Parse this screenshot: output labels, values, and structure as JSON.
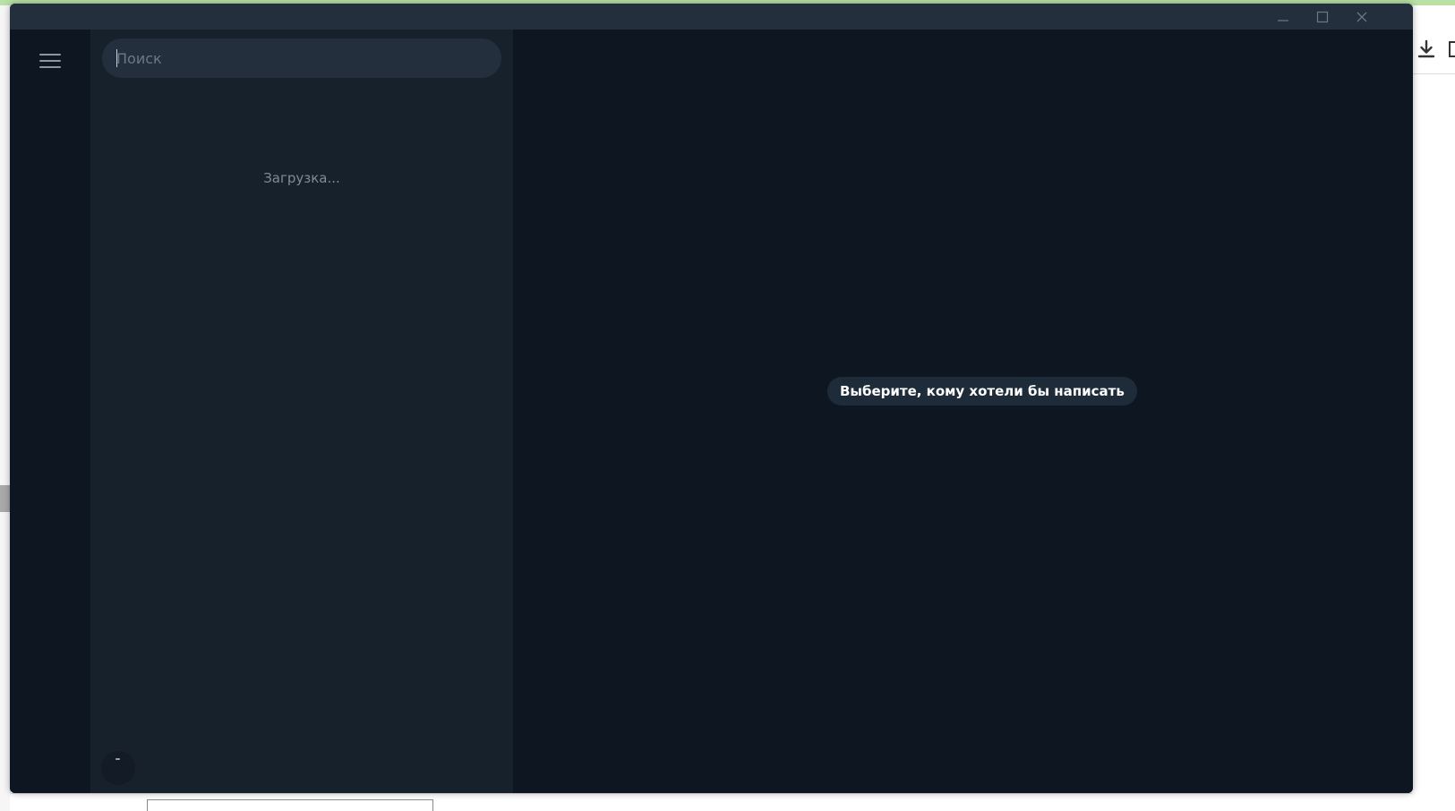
{
  "window": {
    "controls": {
      "minimize_icon": "minimize-icon",
      "maximize_icon": "maximize-icon",
      "close_icon": "close-icon"
    }
  },
  "sidebar": {
    "menu_icon": "hamburger-menu-icon"
  },
  "search": {
    "placeholder": "Поиск",
    "value": ""
  },
  "chat_list": {
    "loading_text": "Загрузка..."
  },
  "chat_area": {
    "empty_hint": "Выберите, кому хотели бы написать"
  },
  "colors": {
    "titlebar": "#242f3d",
    "rail": "#0e1621",
    "chat_list_bg": "#17212b",
    "chat_area_bg": "#0e1621",
    "search_bg": "#242f3d",
    "hint_bg": "#1e2c3a",
    "muted_text": "#7f8b97"
  }
}
